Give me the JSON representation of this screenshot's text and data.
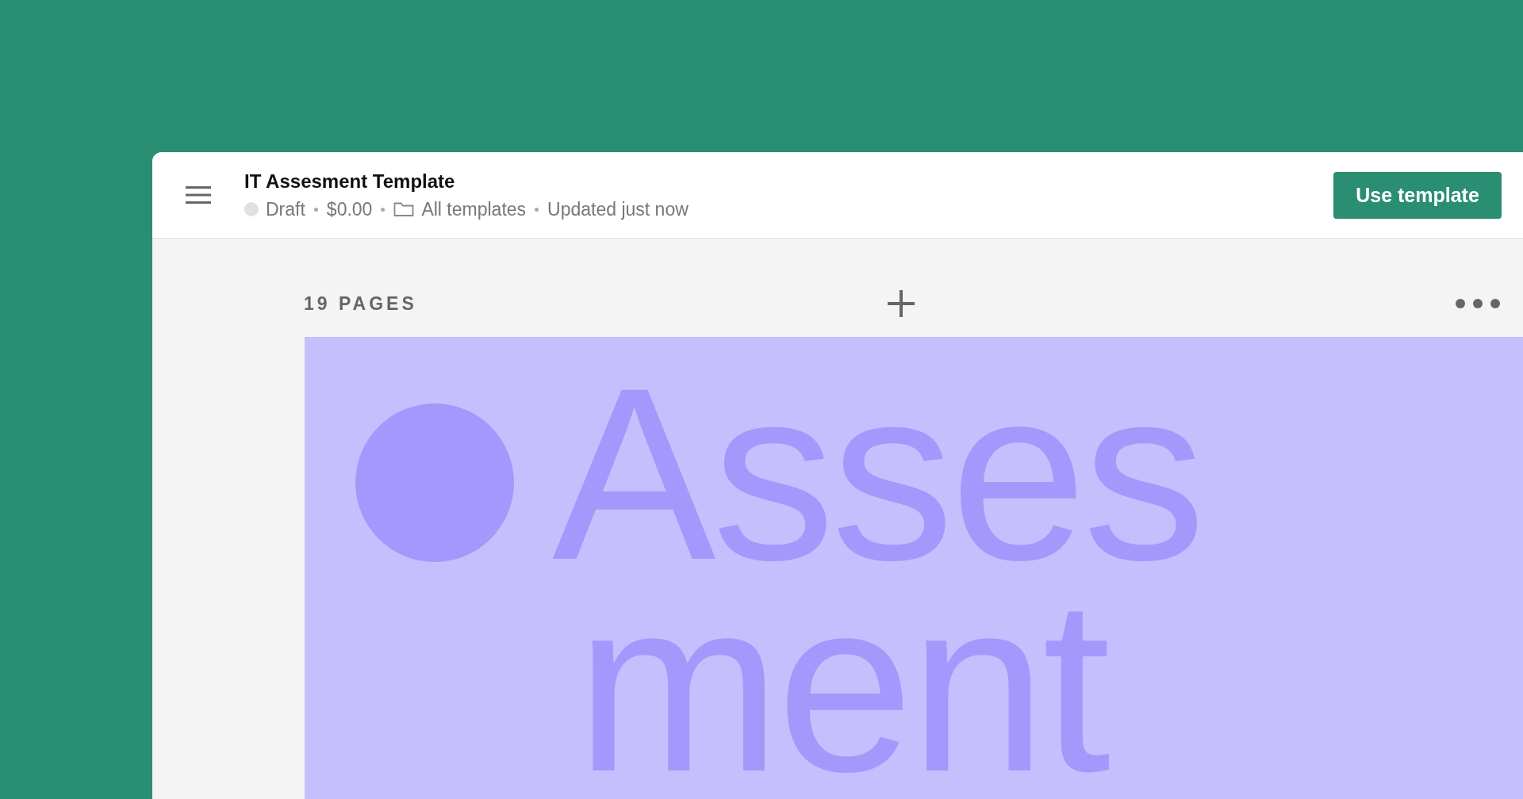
{
  "header": {
    "title": "IT Assesment Template",
    "status": "Draft",
    "price": "$0.00",
    "folder": "All templates",
    "updated": "Updated just now",
    "button": "Use template"
  },
  "pages": {
    "count_label": "19 PAGES"
  },
  "page_preview": {
    "lines": [
      "Asses",
      "ment"
    ]
  }
}
